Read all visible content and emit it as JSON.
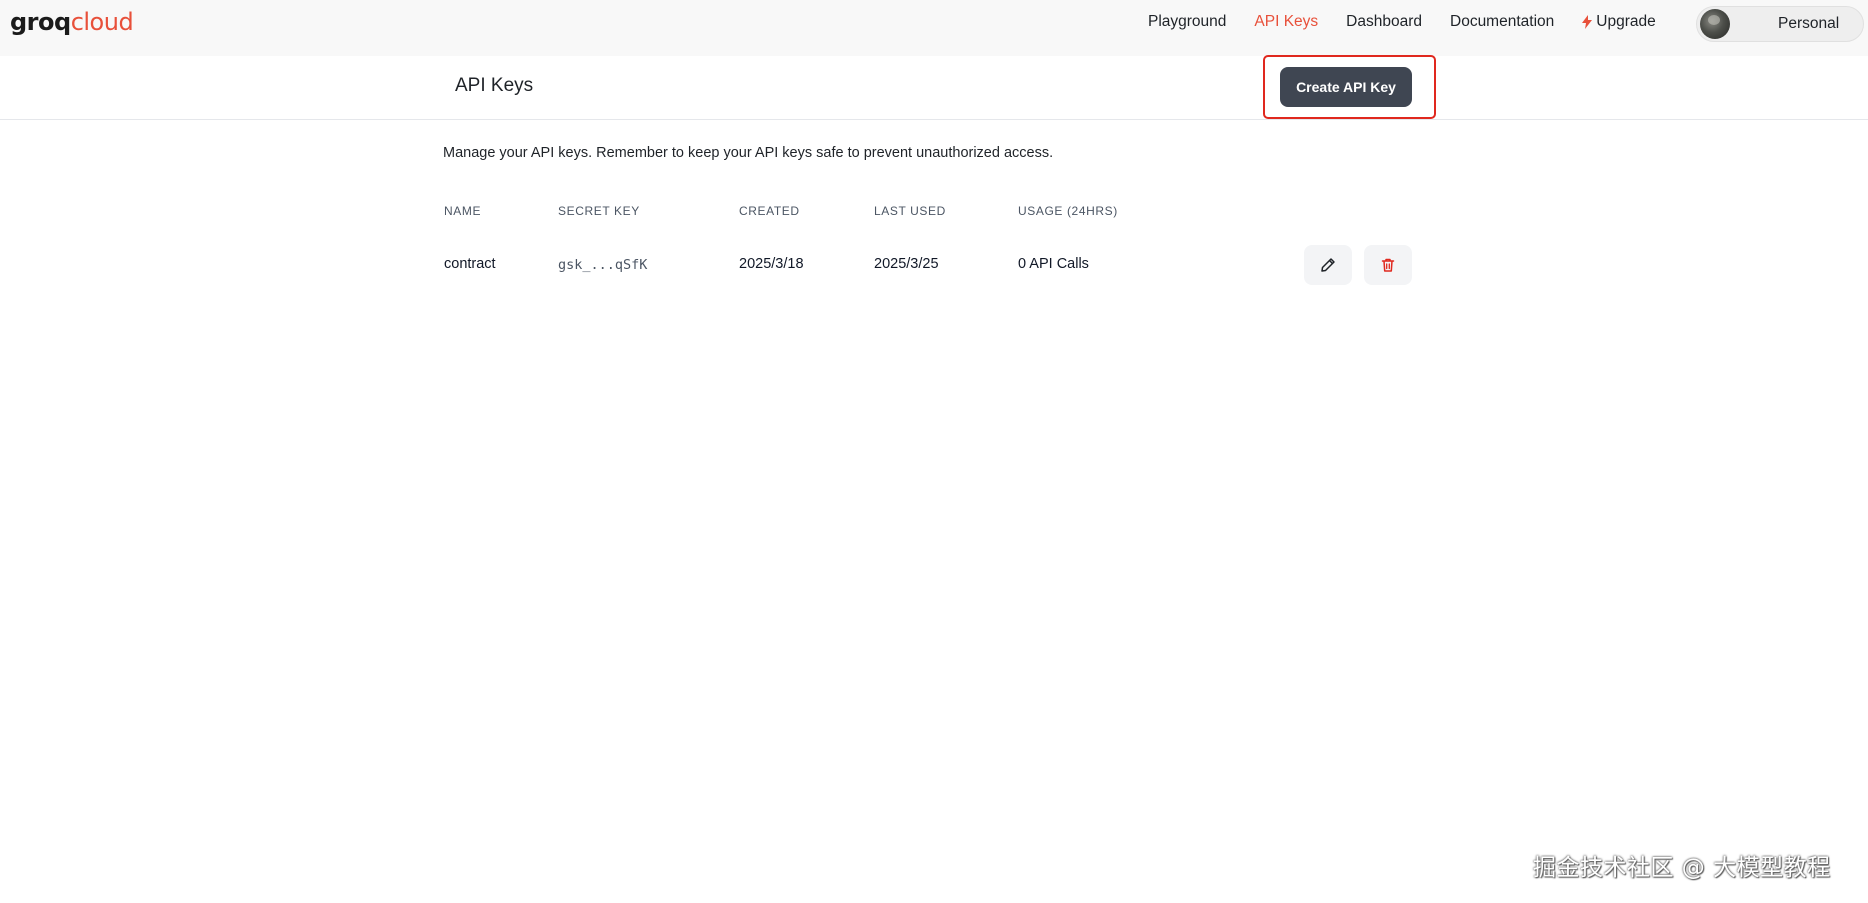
{
  "logo": {
    "part1": "groq",
    "part2": "cloud"
  },
  "nav": {
    "items": [
      {
        "label": "Playground"
      },
      {
        "label": "API Keys",
        "active": true
      },
      {
        "label": "Dashboard"
      },
      {
        "label": "Documentation"
      },
      {
        "label": "Upgrade",
        "icon": "bolt-icon"
      }
    ],
    "account_label": "Personal"
  },
  "header": {
    "title": "API Keys",
    "create_button": "Create API Key"
  },
  "description": "Manage your API keys. Remember to keep your API keys safe to prevent unauthorized access.",
  "table": {
    "columns": [
      "NAME",
      "SECRET KEY",
      "CREATED",
      "LAST USED",
      "USAGE (24HRS)"
    ],
    "rows": [
      {
        "name": "contract",
        "secret_key": "gsk_...qSfK",
        "created": "2025/3/18",
        "last_used": "2025/3/25",
        "usage": "0 API Calls"
      }
    ]
  },
  "watermark": "掘金技术社区 @ 大模型教程",
  "colors": {
    "accent": "#e8503a",
    "button_dark": "#3f4652",
    "highlight": "#e0281e"
  }
}
